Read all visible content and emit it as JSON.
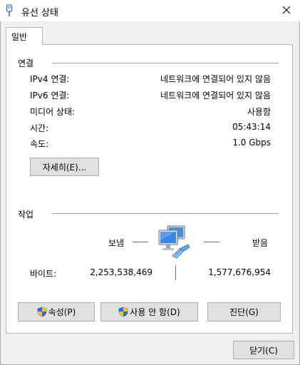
{
  "window": {
    "title": "유선 상태",
    "close_glyph": "✕"
  },
  "tabs": [
    {
      "label": "일반"
    }
  ],
  "connection": {
    "header": "연결",
    "rows": [
      {
        "label": "IPv4 연결:",
        "value": "네트워크에 연결되어 있지 않음"
      },
      {
        "label": "IPv6 연결:",
        "value": "네트워크에 연결되어 있지 않음"
      },
      {
        "label": "미디어 상태:",
        "value": "사용함"
      },
      {
        "label": "시간:",
        "value": "05:43:14"
      },
      {
        "label": "속도:",
        "value": "1.0 Gbps"
      }
    ],
    "details_button": "자세히(E)..."
  },
  "activity": {
    "header": "작업",
    "sent_label": "보냄",
    "received_label": "받음",
    "bytes_label": "바이트:",
    "bytes_sent": "2,253,538,469",
    "bytes_received": "1,577,676,954",
    "icon": "network-computers-icon"
  },
  "actions": {
    "properties": "속성(P)",
    "disable": "사용 안 함(D)",
    "diagnose": "진단(G)"
  },
  "footer": {
    "close_button": "닫기(C)"
  },
  "colors": {
    "shield_blue": "#2f6fd6",
    "shield_yellow": "#f2c32a",
    "monitor_blue": "#4a90d9"
  }
}
